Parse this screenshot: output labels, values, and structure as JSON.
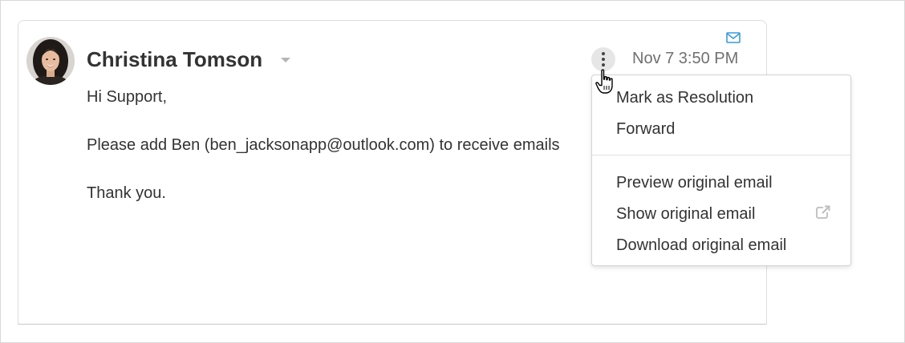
{
  "email": {
    "sender_name": "Christina Tomson",
    "timestamp": "Nov 7 3:50 PM",
    "body": {
      "greeting": "Hi Support,",
      "message": "Please add Ben (ben_jacksonapp@outlook.com) to receive emails",
      "closing": "Thank you."
    }
  },
  "context_menu": {
    "items": [
      {
        "label": "Mark as Resolution"
      },
      {
        "label": "Forward"
      },
      {
        "label": "Preview original email"
      },
      {
        "label": "Show original email",
        "icon": "external-link-icon"
      },
      {
        "label": "Download original email"
      }
    ]
  },
  "icons": {
    "envelope": "envelope-icon",
    "more": "more-vertical-icon",
    "sender_dropdown": "chevron-down-icon",
    "cursor": "hand-pointer-icon"
  },
  "colors": {
    "envelope_accent": "#3a9ad9",
    "text_primary": "#333333",
    "text_secondary": "#707070"
  }
}
